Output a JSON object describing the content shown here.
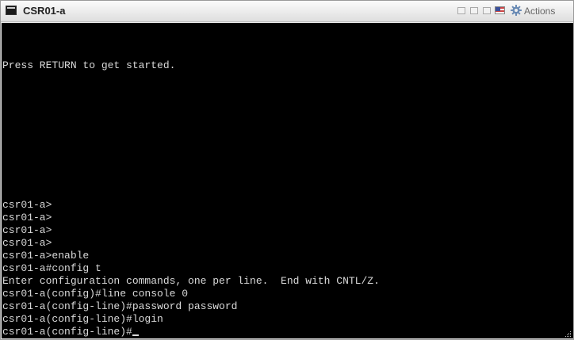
{
  "window": {
    "title": "CSR01-a",
    "actions_label": "Actions"
  },
  "terminal": {
    "banner": "Press RETURN to get started.",
    "lines": [
      "csr01-a>",
      "csr01-a>",
      "csr01-a>",
      "csr01-a>",
      "csr01-a>enable",
      "csr01-a#config t",
      "Enter configuration commands, one per line.  End with CNTL/Z.",
      "csr01-a(config)#line console 0",
      "csr01-a(config-line)#password password",
      "csr01-a(config-line)#login",
      "csr01-a(config-line)#"
    ]
  },
  "colors": {
    "terminal_bg": "#000000",
    "terminal_fg": "#d9d9d9"
  },
  "icons": {
    "app": "terminal-icon",
    "settings": "gear-icon",
    "language": "flag-icon"
  }
}
